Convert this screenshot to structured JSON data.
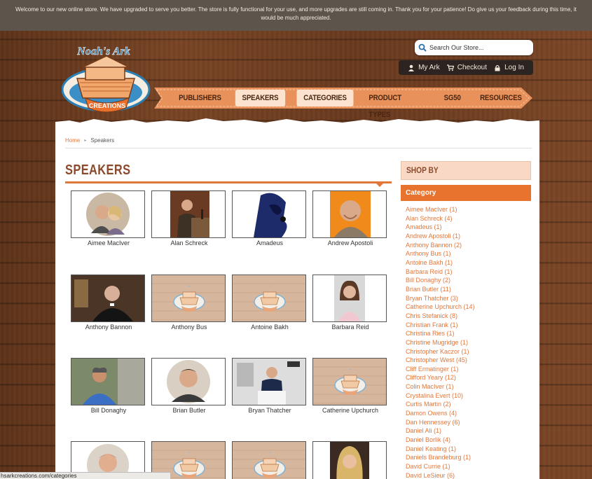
{
  "notice": "Welcome to our new online store. We have upgraded to serve you better. The store is fully functional for your use, and more upgrades are still coming in. Thank you for your patience! Do give us your feedback during this time, it would be much appreciated.",
  "logo": {
    "top_text": "Noah's Ark",
    "bottom_text": "CREATIONS"
  },
  "search": {
    "placeholder": "Search Our Store..."
  },
  "account": {
    "my_ark": "My Ark",
    "checkout": "Checkout",
    "login": "Log In"
  },
  "nav": {
    "items": [
      {
        "label": "PUBLISHERS",
        "active": false
      },
      {
        "label": "SPEAKERS",
        "active": true
      },
      {
        "label": "CATEGORIES",
        "active": true
      },
      {
        "label": "PRODUCT TYPES",
        "active": false
      },
      {
        "label": "SG50",
        "active": false
      },
      {
        "label": "RESOURCES",
        "active": false
      }
    ]
  },
  "breadcrumb": {
    "home": "Home",
    "current": "Speakers"
  },
  "page_title": "SPEAKERS",
  "speakers": [
    {
      "name": "Aimee MacIver",
      "image": "photo-couple"
    },
    {
      "name": "Alan Schreck",
      "image": "photo-podium"
    },
    {
      "name": "Amadeus",
      "image": "photo-cartoon"
    },
    {
      "name": "Andrew Apostoli",
      "image": "photo-friar"
    },
    {
      "name": "Anthony Bannon",
      "image": "photo-priest"
    },
    {
      "name": "Anthony Bus",
      "image": "placeholder-logo"
    },
    {
      "name": "Antoine Bakh",
      "image": "placeholder-logo"
    },
    {
      "name": "Barbara Reid",
      "image": "photo-woman"
    },
    {
      "name": "Bill Donaghy",
      "image": "photo-outdoor"
    },
    {
      "name": "Brian Butler",
      "image": "photo-man"
    },
    {
      "name": "Bryan Thatcher",
      "image": "photo-speaker"
    },
    {
      "name": "Catherine Upchurch",
      "image": "placeholder-logo"
    },
    {
      "name": "",
      "image": "photo-man-round"
    },
    {
      "name": "",
      "image": "placeholder-logo"
    },
    {
      "name": "",
      "image": "placeholder-logo"
    },
    {
      "name": "",
      "image": "photo-blonde"
    }
  ],
  "sidebar": {
    "title": "SHOP BY",
    "category_heading": "Category",
    "categories": [
      "Aimee MacIver (1)",
      "Alan Schreck (4)",
      "Amadeus (1)",
      "Andrew Apostoli (1)",
      "Anthony Bannon (2)",
      "Anthony Bus (1)",
      "Antoine Bakh (1)",
      "Barbara Reid (1)",
      "Bill Donaghy (2)",
      "Brian Butler (11)",
      "Bryan Thatcher (3)",
      "Catherine Upchurch (14)",
      "Chris Stefanick (8)",
      "Christian Frank (1)",
      "Christina Ries (1)",
      "Christine Mugridge (1)",
      "Christopher Kaczor (1)",
      "Christopher West (45)",
      "Cliff Ermatinger (1)",
      "Clifford Yeary (12)",
      "Colin MacIver (1)",
      "Crystalina Evert (10)",
      "Curtis Martin (2)",
      "Damon Owens (4)",
      "Dan Hennessey (6)",
      "Daniel Ali (1)",
      "Daniel Borlik (4)",
      "Daniel Keating (1)",
      "Daniels Brandeburg (1)",
      "David Currie (1)",
      "David LeSieur (6)"
    ]
  },
  "status_bar": "hsarkcreations.com/categories",
  "colors": {
    "accent": "#e2773a",
    "title": "#8b4a2b",
    "nav_bg": "#e8915a",
    "category_bar": "#e8732f"
  }
}
